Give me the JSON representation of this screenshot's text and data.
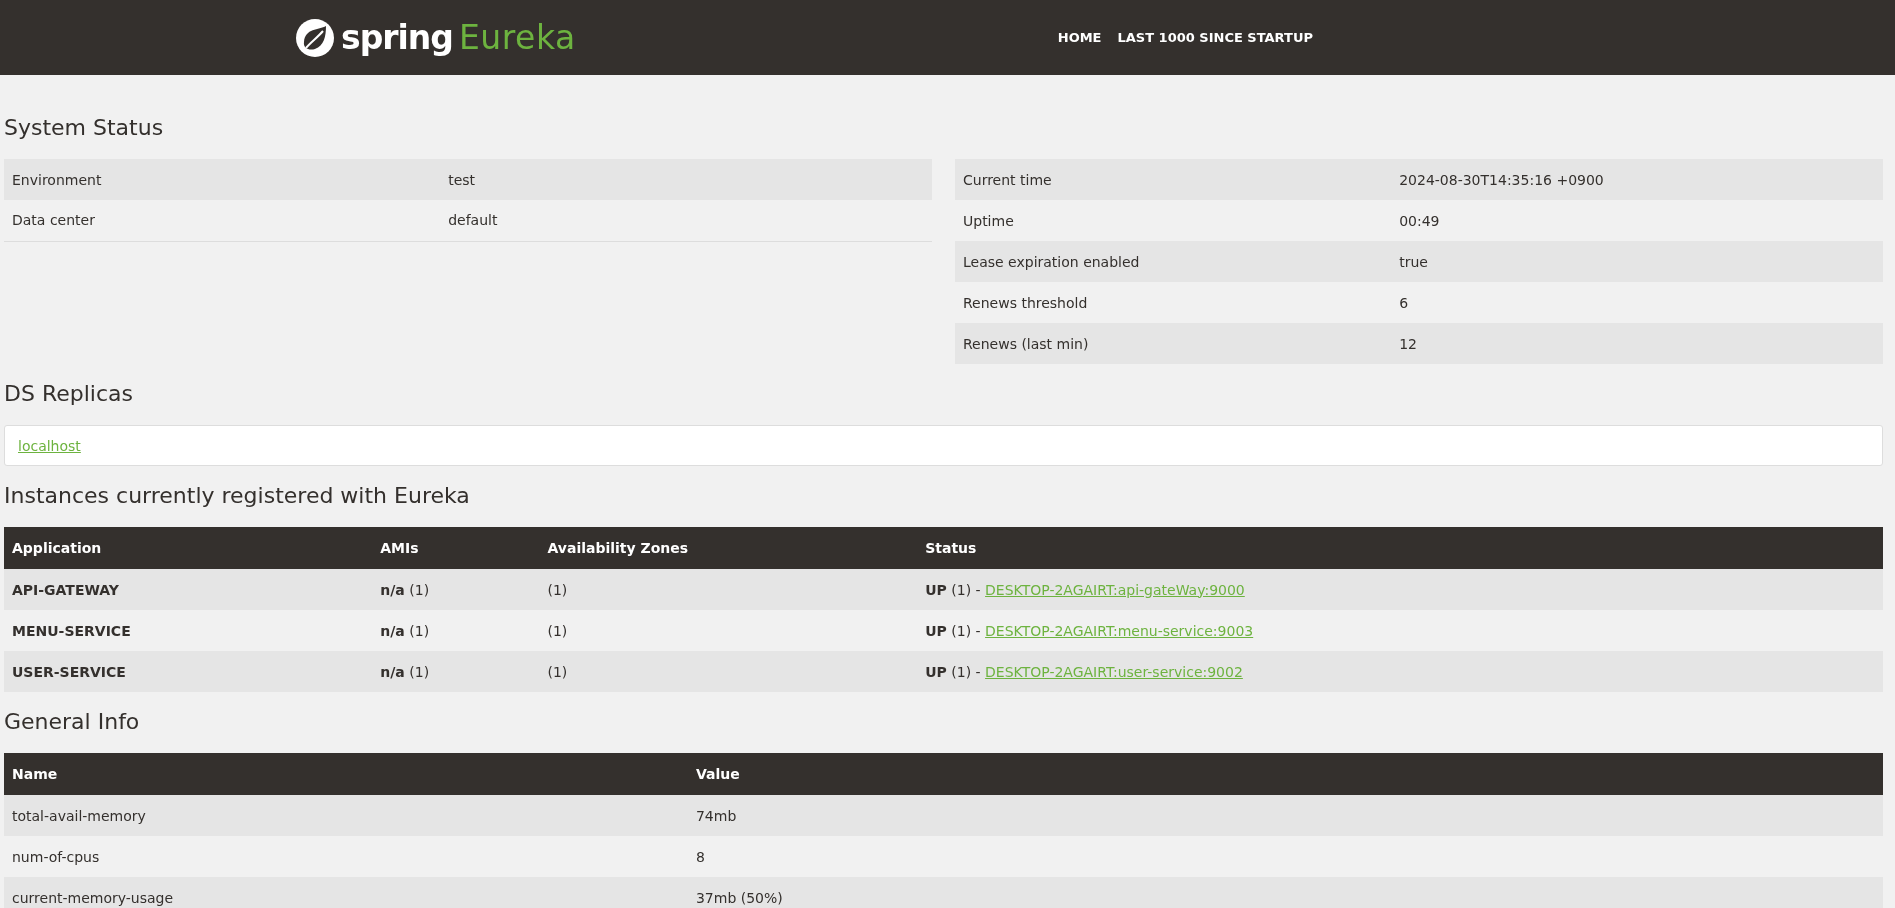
{
  "header": {
    "logo_word": "spring",
    "logo_product": "Eureka",
    "nav": [
      {
        "label": "HOME"
      },
      {
        "label": "LAST 1000 SINCE STARTUP"
      }
    ]
  },
  "system_status": {
    "title": "System Status",
    "left": [
      {
        "name": "Environment",
        "value": "test"
      },
      {
        "name": "Data center",
        "value": "default"
      }
    ],
    "right": [
      {
        "name": "Current time",
        "value": "2024-08-30T14:35:16 +0900"
      },
      {
        "name": "Uptime",
        "value": "00:49"
      },
      {
        "name": "Lease expiration enabled",
        "value": "true"
      },
      {
        "name": "Renews threshold",
        "value": "6"
      },
      {
        "name": "Renews (last min)",
        "value": "12"
      }
    ]
  },
  "ds_replicas": {
    "title": "DS Replicas",
    "links": [
      "localhost"
    ]
  },
  "instances": {
    "title": "Instances currently registered with Eureka",
    "columns": [
      "Application",
      "AMIs",
      "Availability Zones",
      "Status"
    ],
    "rows": [
      {
        "application": "API-GATEWAY",
        "amis": "**n/a** (1)",
        "zones": "(1)",
        "status": "**UP** (1) -",
        "instance_link": "DESKTOP-2AGAIRT:api-gateWay:9000"
      },
      {
        "application": "MENU-SERVICE",
        "amis": "**n/a** (1)",
        "zones": "(1)",
        "status": "**UP** (1) -",
        "instance_link": "DESKTOP-2AGAIRT:menu-service:9003"
      },
      {
        "application": "USER-SERVICE",
        "amis": "**n/a** (1)",
        "zones": "(1)",
        "status": "**UP** (1) -",
        "instance_link": "DESKTOP-2AGAIRT:user-service:9002"
      }
    ]
  },
  "general_info": {
    "title": "General Info",
    "columns": [
      "Name",
      "Value"
    ],
    "rows": [
      {
        "name": "total-avail-memory",
        "value": "74mb"
      },
      {
        "name": "num-of-cpus",
        "value": "8"
      },
      {
        "name": "current-memory-usage",
        "value": "37mb (50%)"
      }
    ]
  }
}
